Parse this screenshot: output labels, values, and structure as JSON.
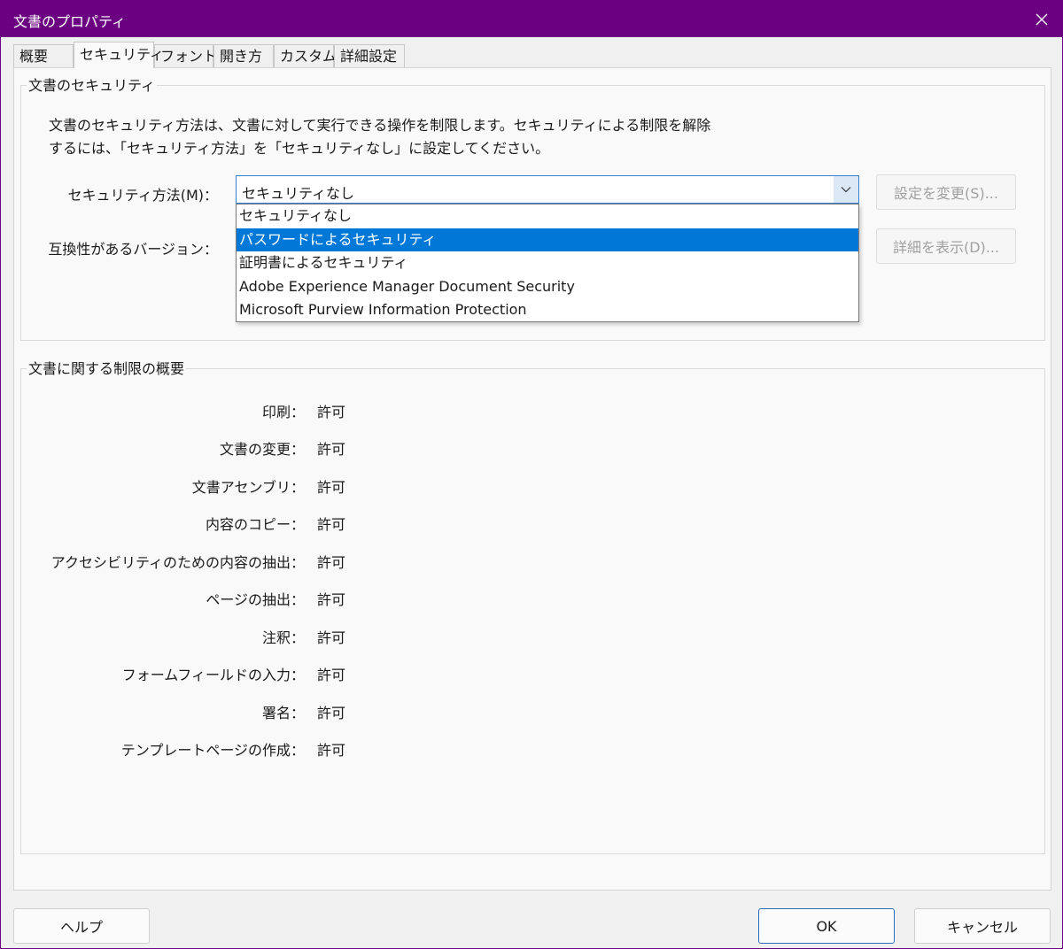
{
  "window": {
    "title": "文書のプロパティ",
    "accent_color": "#6b0080"
  },
  "tabs": [
    {
      "label": "概要",
      "active": false
    },
    {
      "label": "セキュリティ",
      "active": true
    },
    {
      "label": "フォント",
      "active": false
    },
    {
      "label": "開き方",
      "active": false
    },
    {
      "label": "カスタム",
      "active": false
    },
    {
      "label": "詳細設定",
      "active": false
    }
  ],
  "security_group": {
    "legend": "文書のセキュリティ",
    "description_line1": "文書のセキュリティ方法は、文書に対して実行できる操作を制限します。セキュリティによる制限を解除",
    "description_line2": "するには、「セキュリティ方法」を「セキュリティなし」に設定してください。",
    "method_label": "セキュリティ方法(M)：",
    "method_value": "セキュリティなし",
    "compat_label": "互換性があるバージョン：",
    "change_settings_button": "設定を変更(S)...",
    "show_details_button": "詳細を表示(D)...",
    "dropdown_options": [
      {
        "label": "セキュリティなし",
        "selected": false
      },
      {
        "label": "パスワードによるセキュリティ",
        "selected": true
      },
      {
        "label": "証明書によるセキュリティ",
        "selected": false
      },
      {
        "label": "Adobe Experience Manager Document Security",
        "selected": false
      },
      {
        "label": "Microsoft Purview Information Protection",
        "selected": false
      }
    ]
  },
  "restrictions_group": {
    "legend": "文書に関する制限の概要",
    "rows": [
      {
        "label": "印刷：",
        "value": "許可"
      },
      {
        "label": "文書の変更：",
        "value": "許可"
      },
      {
        "label": "文書アセンブリ：",
        "value": "許可"
      },
      {
        "label": "内容のコピー：",
        "value": "許可"
      },
      {
        "label": "アクセシビリティのための内容の抽出：",
        "value": "許可"
      },
      {
        "label": "ページの抽出：",
        "value": "許可"
      },
      {
        "label": "注釈：",
        "value": "許可"
      },
      {
        "label": "フォームフィールドの入力：",
        "value": "許可"
      },
      {
        "label": "署名：",
        "value": "許可"
      },
      {
        "label": "テンプレートページの作成：",
        "value": "許可"
      }
    ]
  },
  "footer": {
    "help_button": "ヘルプ",
    "ok_button": "OK",
    "cancel_button": "キャンセル"
  },
  "icons": {
    "close": "close-icon",
    "dropdown": "chevron-down-icon"
  }
}
